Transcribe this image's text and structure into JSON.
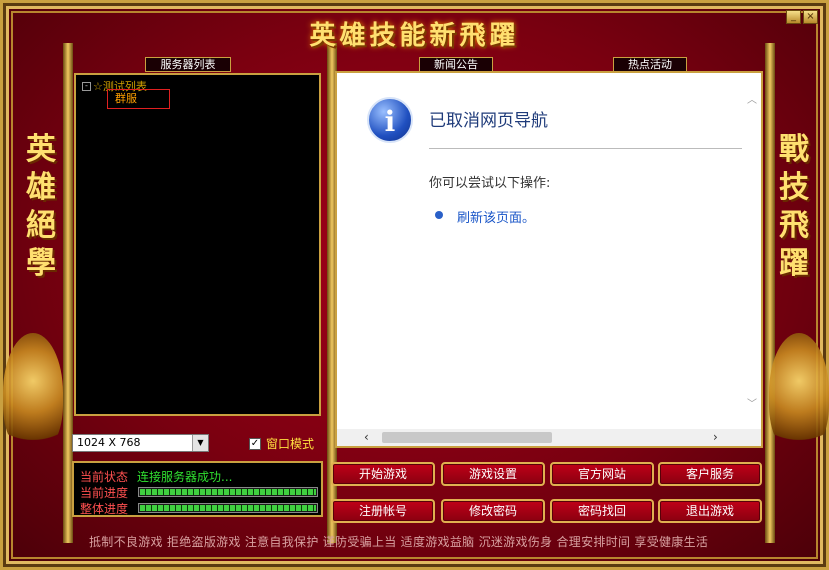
{
  "header": {
    "title": "英雄技能新飛躍"
  },
  "window_controls": {
    "minimize": "_",
    "close": "×"
  },
  "side": {
    "left": "英雄絕學",
    "right": "戰技飛躍"
  },
  "labels": {
    "server_list": "服务器列表",
    "news": "新闻公告",
    "events": "热点活动"
  },
  "server_tree": {
    "root": "☆测试列表",
    "child": "群服"
  },
  "browser": {
    "title": "已取消网页导航",
    "subtitle": "你可以尝试以下操作:",
    "link": "刷新该页面。"
  },
  "options": {
    "resolution": "1024 X 768",
    "window_mode": "窗口模式",
    "window_mode_checked": true
  },
  "status": {
    "state_label": "当前状态",
    "state_value": "连接服务器成功...",
    "current_label": "当前进度",
    "overall_label": "整体进度",
    "current_progress": 1.0,
    "overall_progress": 1.0
  },
  "buttons": {
    "start_game": "开始游戏",
    "game_settings": "游戏设置",
    "official_site": "官方网站",
    "customer_service": "客户服务",
    "register": "注册帐号",
    "change_password": "修改密码",
    "recover_password": "密码找回",
    "exit_game": "退出游戏"
  },
  "footer": {
    "slogan": "抵制不良游戏 拒绝盗版游戏 注意自我保护 谨防受骗上当 适度游戏益脑 沉迷游戏伤身 合理安排时间 享受健康生活"
  },
  "colors": {
    "background": "#8a0012",
    "gold": "#c9a040",
    "title_gold": "#ffe070"
  }
}
